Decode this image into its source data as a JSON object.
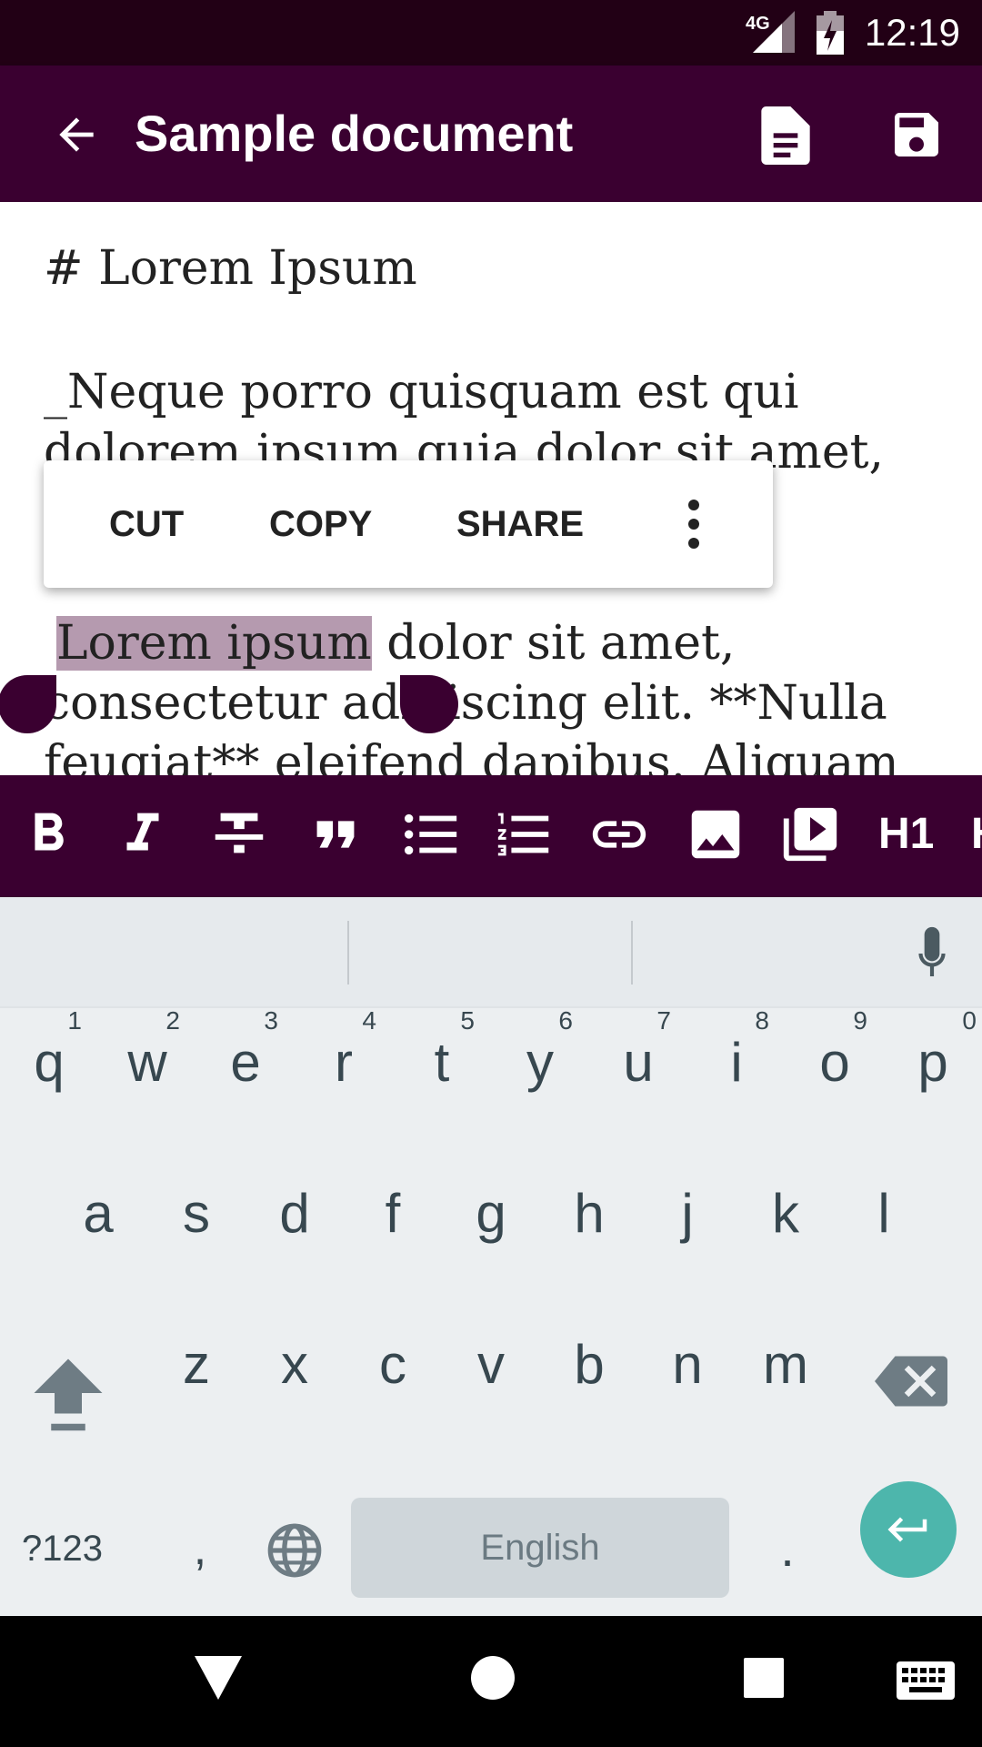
{
  "status_bar": {
    "network": "4G",
    "time": "12:19"
  },
  "app_bar": {
    "title": "Sample document",
    "back_icon": "arrow-back-icon",
    "document_icon": "document-icon",
    "save_icon": "save-icon"
  },
  "editor": {
    "lines": [
      "# Lorem Ipsum",
      " _Neque porro quisquam est qui",
      "dolorem ipsum quia dolor sit amet,",
      "Lorem ipsum",
      " dolor sit amet,",
      "consectetur adipiscing elit. **Nulla",
      "feugiat** eleifend dapibus. Aliquam"
    ],
    "selected_text": "Lorem ipsum",
    "selection_color": "#b59aaf"
  },
  "context_menu": {
    "cut": "CUT",
    "copy": "COPY",
    "share": "SHARE",
    "more_icon": "more-vertical-icon"
  },
  "format_bar": {
    "items": [
      "bold-icon",
      "italic-icon",
      "strikethrough-icon",
      "quote-icon",
      "bullet-list-icon",
      "numbered-list-icon",
      "link-icon",
      "image-icon",
      "video-icon"
    ],
    "h1": "H1",
    "h2": "H"
  },
  "keyboard": {
    "row1": [
      {
        "key": "q",
        "hint": "1"
      },
      {
        "key": "w",
        "hint": "2"
      },
      {
        "key": "e",
        "hint": "3"
      },
      {
        "key": "r",
        "hint": "4"
      },
      {
        "key": "t",
        "hint": "5"
      },
      {
        "key": "y",
        "hint": "6"
      },
      {
        "key": "u",
        "hint": "7"
      },
      {
        "key": "i",
        "hint": "8"
      },
      {
        "key": "o",
        "hint": "9"
      },
      {
        "key": "p",
        "hint": "0"
      }
    ],
    "row2": [
      "a",
      "s",
      "d",
      "f",
      "g",
      "h",
      "j",
      "k",
      "l"
    ],
    "row3": [
      "z",
      "x",
      "c",
      "v",
      "b",
      "n",
      "m"
    ],
    "symbols": "?123",
    "comma": ",",
    "space": "English",
    "period": ".",
    "accent": "#4db6ac"
  },
  "colors": {
    "primary": "#3a0030",
    "status": "#220015"
  }
}
